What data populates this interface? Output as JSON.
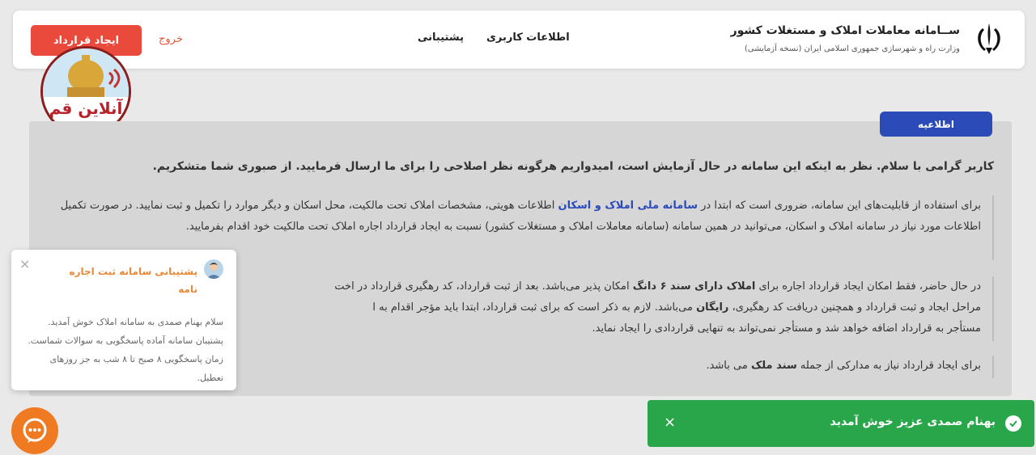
{
  "header": {
    "title": "ســامانه معاملات املاک و مستغلات کشور",
    "subtitle": "وزارت راه و شهرسازی جمهوری اسلامی ایران (نسخه آزمایشی)",
    "nav": [
      "اطلاعات کاربری",
      "پشتیبانی"
    ],
    "logout": "خروج",
    "create_button": "ایجاد قرارداد"
  },
  "channel_logo_text": "آنلاین قم",
  "notice": {
    "tab": "اطلاعیه",
    "greeting": "کاربر گرامی با سلام. نظر به اینکه این سامانه در حال آزمایش است، امیدواریم هرگونه نظر اصلاحی را برای ما ارسال فرمایید. از صبوری شما متشکریم.",
    "p1_a": "برای استفاده از قابلیت‌های این سامانه، ضروری است که ابتدا در ",
    "p1_link": "سامانه ملی املاک و اسکان",
    "p1_b": " اطلاعات هویتی، مشخصات املاک تحت مالکیت، محل اسکان و دیگر موارد را تکمیل و ثبت نمایید. در صورت تکمیل اطلاعات مورد نیاز در سامانه املاک و اسکان، می‌توانید در همین سامانه (سامانه معاملات املاک و مستغلات کشور) نسبت به ایجاد قرارداد اجاره املاک تحت مالکیت خود اقدام بفرمایید.",
    "p2_a": "در حال حاضر، فقط امکان ایجاد قرارداد اجاره برای ",
    "p2_bold1": "املاک دارای سند ۶ دانگ",
    "p2_b": " امکان پذیر می‌باشد. بعد از ثبت قرارداد، کد رهگیری قرارداد در اخت",
    "p2_c": "مراحل ایجاد و ثبت قرارداد و همچنین دریافت کد رهگیری، ",
    "p2_bold2": "رایگان",
    "p2_d": " می‌باشد. لازم به ذکر است که برای ثبت قرارداد، ابتدا باید مؤجر اقدام به ا",
    "p2_e": "مستأجر به قرارداد اضافه خواهد شد و مستأجر نمی‌تواند به تنهایی قراردادی را ایجاد نماید.",
    "p3_a": "برای ایجاد قرارداد نیاز به مدارکی از جمله ",
    "p3_bold": "سند ملک",
    "p3_b": " می باشد."
  },
  "support": {
    "title": "پشتیبانی سامانه ثبت اجاره نامه",
    "body": "سلام بهنام صمدی به سامانه املاک خوش آمدید. پشتیبان سامانه آماده پاسخگویی به سوالات شماست. زمان پاسخگویی ۸ صبح تا ۸ شب به جز روزهای تعطیل."
  },
  "toast": {
    "text": "بهنام صمدی عزیز خوش آمدید"
  },
  "colors": {
    "accent_red": "#ea4a3b",
    "notice_blue": "#2b4bb9",
    "toast_green": "#2aa64a",
    "support_orange": "#f07a22"
  }
}
